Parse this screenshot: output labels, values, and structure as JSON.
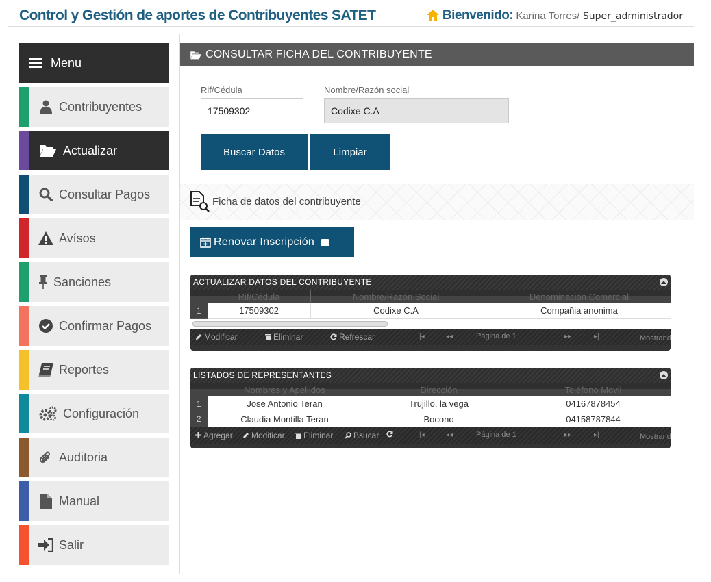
{
  "header": {
    "title": "Control y Gestión de aportes de Contribuyentes SATET",
    "welcome_label": "Bienvenido:",
    "user_name": "Karina Torres/",
    "user_role": " Super_administrador"
  },
  "sidebar": {
    "menu_label": "Menu",
    "items": [
      {
        "label": "Contribuyentes",
        "icon": "user-icon",
        "color": "#1f9e6e"
      },
      {
        "label": "Actualizar",
        "icon": "folder-open-icon",
        "color": "#6b4a9e"
      },
      {
        "label": "Consultar Pagos",
        "icon": "search-icon",
        "color": "#0f4f73"
      },
      {
        "label": "Avísos",
        "icon": "warning-icon",
        "color": "#d0262b"
      },
      {
        "label": "Sanciones",
        "icon": "pushpin-icon",
        "color": "#1f9e6e"
      },
      {
        "label": "Confirmar Pagos",
        "icon": "check-circle-icon",
        "color": "#f4735e"
      },
      {
        "label": "Reportes",
        "icon": "book-icon",
        "color": "#f5c02a"
      },
      {
        "label": "Configuración",
        "icon": "cogs-icon",
        "color": "#0e8a9a"
      },
      {
        "label": "Auditoria",
        "icon": "paperclip-icon",
        "color": "#8a5a2e"
      },
      {
        "label": "Manual",
        "icon": "file-icon",
        "color": "#3c5ea8"
      },
      {
        "label": "Salir",
        "icon": "sign-in-icon",
        "color": "#f5532f"
      }
    ]
  },
  "panel": {
    "title": "CONSULTAR FICHA DEL CONTRIBUYENTE"
  },
  "form": {
    "rif_label": "Rif/Cédula",
    "rif_value": "17509302",
    "nombre_label": "Nombre/Razón social",
    "nombre_value": "Codixe C.A",
    "buscar_label": "Buscar Datos",
    "limpiar_label": "Limpiar"
  },
  "ficha": {
    "label": "Ficha de datos del contribuyente"
  },
  "renovar": {
    "label": "Renovar Inscripción"
  },
  "grid_contribuyente": {
    "title": "ACTUALIZAR DATOS DEL CONTRIBUYENTE",
    "columns": [
      "Rif/Cédula",
      "Nombre/Razón Social",
      "Denominación Comercial"
    ],
    "rows": [
      {
        "num": "1",
        "cells": [
          "17509302",
          "Codixe C.A",
          "Compañia anonima"
        ]
      }
    ],
    "pager": {
      "modificar": "Modificar",
      "eliminar": "Eliminar",
      "refrescar": "Refrescar",
      "page_text": "Página de 1",
      "mostrando": "Mostrando"
    }
  },
  "grid_representantes": {
    "title": "LISTADOS DE REPRESENTANTES",
    "columns": [
      "Nombres y Apellidos",
      "Dirección",
      "Teléfono Movil"
    ],
    "rows": [
      {
        "num": "1",
        "cells": [
          "Jose Antonio Teran",
          "Trujillo, la vega",
          "04167878454"
        ]
      },
      {
        "num": "2",
        "cells": [
          "Claudia Montilla Teran",
          "Bocono",
          "04158787844"
        ]
      }
    ],
    "pager": {
      "agregar": "Agregar",
      "modificar": "Modificar",
      "eliminar": "Eliminar",
      "buscar": "Bsucar",
      "page_text": "Página de 1",
      "mostrando": "Mostrando"
    }
  }
}
